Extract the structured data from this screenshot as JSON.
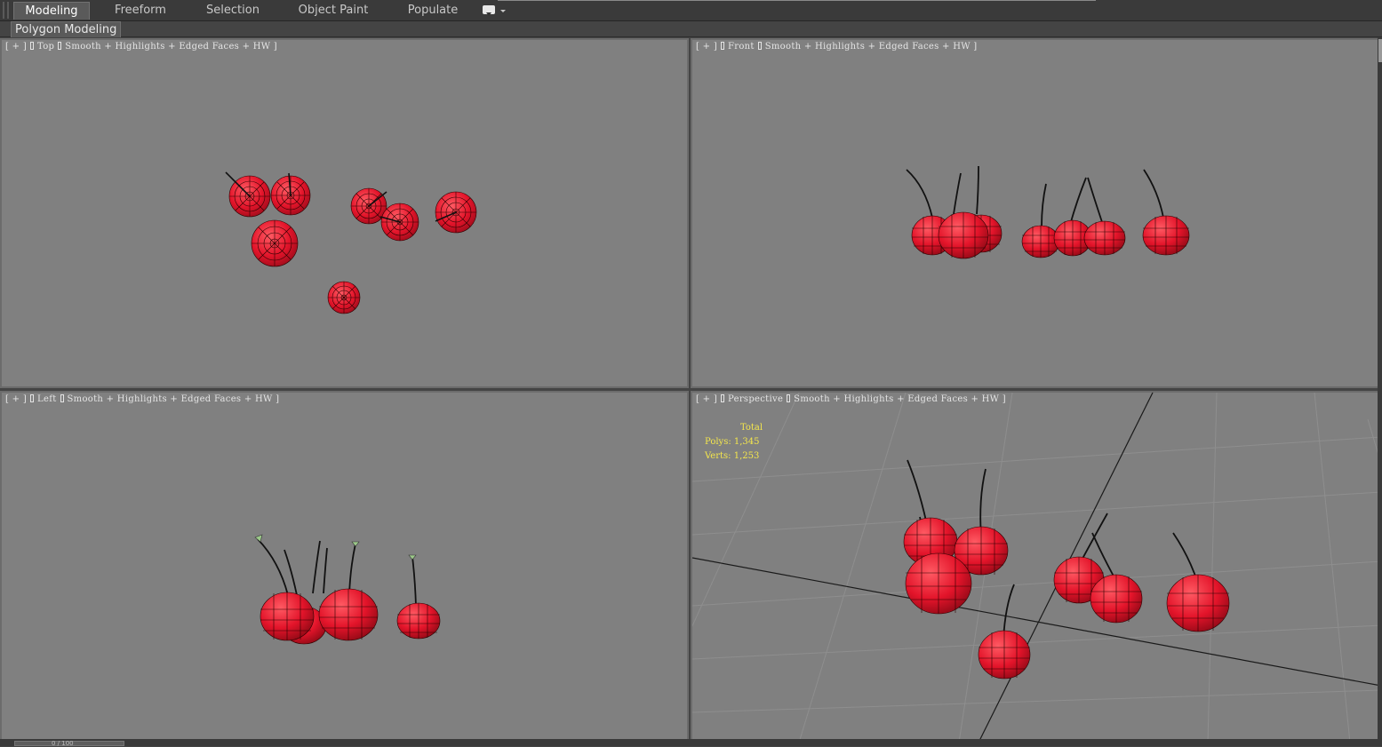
{
  "ribbon": {
    "tabs": [
      {
        "label": "Modeling",
        "active": true
      },
      {
        "label": "Freeform",
        "active": false
      },
      {
        "label": "Selection",
        "active": false
      },
      {
        "label": "Object Paint",
        "active": false
      },
      {
        "label": "Populate",
        "active": false
      }
    ],
    "panel_label": "Polygon Modeling"
  },
  "viewports": {
    "top": {
      "plus": "[ + ]",
      "name": "Top",
      "shading": "Smooth + Highlights + Edged Faces + HW ]"
    },
    "front": {
      "plus": "[ + ]",
      "name": "Front",
      "shading": "Smooth + Highlights + Edged Faces + HW ]"
    },
    "left": {
      "plus": "[ + ]",
      "name": "Left",
      "shading": "Smooth + Highlights + Edged Faces + HW ]"
    },
    "perspective": {
      "plus": "[ + ]",
      "name": "Perspective",
      "shading": "Smooth + Highlights + Edged Faces + HW ]"
    }
  },
  "stats": {
    "heading": "Total",
    "polys": "Polys: 1,345",
    "verts": "Verts: 1,253"
  },
  "timeline": {
    "frame": "0 / 100"
  },
  "colors": {
    "viewport_bg": "#808080",
    "cherry_red": "#e3142a",
    "stats_yellow": "#f4e64c",
    "ui_dark": "#444444"
  },
  "icons": [
    "menu-toggle-icon",
    "dropdown-arrow-icon"
  ]
}
